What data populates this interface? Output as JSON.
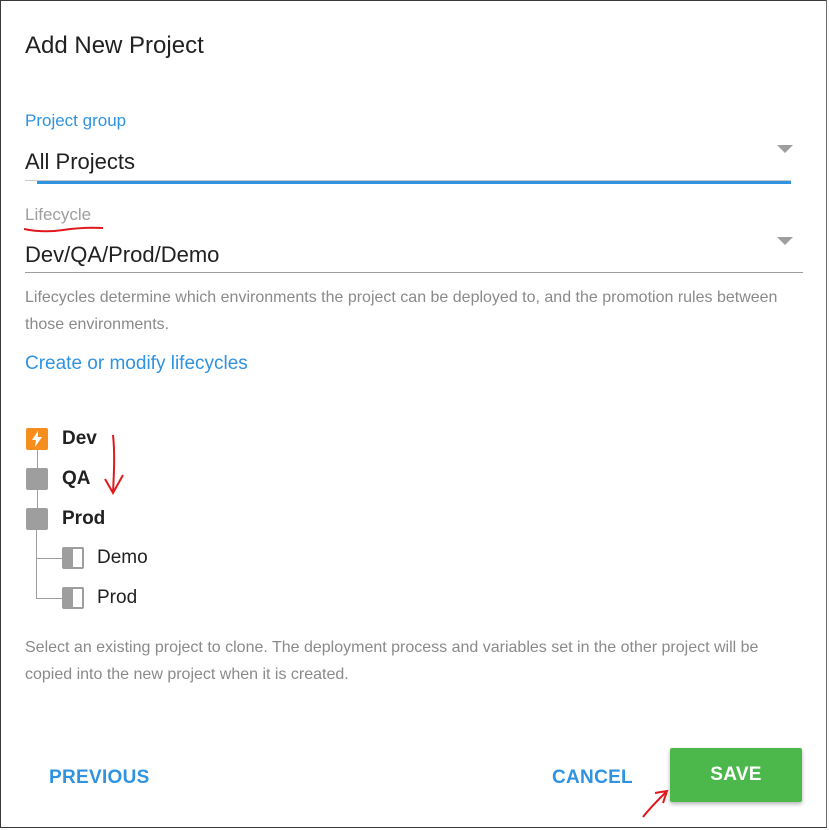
{
  "dialog": {
    "title": "Add New Project"
  },
  "project_group": {
    "label": "Project group",
    "value": "All Projects"
  },
  "lifecycle": {
    "label": "Lifecycle",
    "value": "Dev/QA/Prod/Demo",
    "help_text": "Lifecycles determine which environments the project can be deployed to, and the promotion rules between those environments.",
    "link_label": "Create or modify lifecycles"
  },
  "phases": [
    {
      "label": "Dev",
      "icon": "bolt-icon",
      "state": "active"
    },
    {
      "label": "QA",
      "icon": "square-icon",
      "state": "pending"
    },
    {
      "label": "Prod",
      "icon": "square-icon",
      "state": "pending"
    },
    {
      "label": "Demo",
      "icon": "half-square-icon",
      "state": "optional"
    },
    {
      "label": "Prod",
      "icon": "half-square-icon",
      "state": "optional"
    }
  ],
  "clone": {
    "help_text": "Select an existing project to clone. The deployment process and variables set in the other project will be copied into the new project when it is created."
  },
  "buttons": {
    "previous": "PREVIOUS",
    "cancel": "CANCEL",
    "save": "SAVE"
  },
  "colors": {
    "accent_blue": "#2f93e0",
    "save_green": "#4cb84c",
    "active_phase": "#f68e1e",
    "annotation_red": "#e0191e"
  }
}
